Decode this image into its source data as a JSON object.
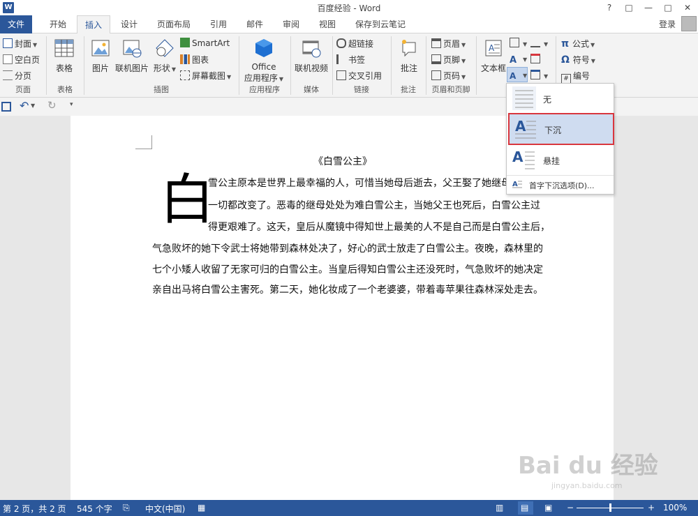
{
  "window": {
    "title": "百度经验 - Word",
    "help": "?",
    "restore": "□",
    "minimize": "—",
    "close": "✕"
  },
  "tabs": {
    "file": "文件",
    "items": [
      "开始",
      "插入",
      "设计",
      "页面布局",
      "引用",
      "邮件",
      "审阅",
      "视图",
      "保存到云笔记"
    ],
    "active": "插入",
    "login": "登录"
  },
  "ribbon": {
    "pages": {
      "cover": "封面",
      "blank": "空白页",
      "break": "分页",
      "label": "页面"
    },
    "tables": {
      "table": "表格",
      "label": "表格"
    },
    "illustrations": {
      "picture": "图片",
      "online_picture": "联机图片",
      "shapes": "形状",
      "smartart": "SmartArt",
      "chart": "图表",
      "screenshot": "屏幕截图",
      "label": "插图"
    },
    "apps": {
      "line1": "Office",
      "line2": "应用程序",
      "label": "应用程序"
    },
    "media": {
      "online_video": "联机视频",
      "label": "媒体"
    },
    "links": {
      "hyperlink": "超链接",
      "bookmark": "书签",
      "cross_ref": "交叉引用",
      "label": "链接"
    },
    "comments": {
      "comment": "批注",
      "label": "批注"
    },
    "header_footer": {
      "header": "页眉",
      "footer": "页脚",
      "page_number": "页码",
      "label": "页眉和页脚"
    },
    "text": {
      "textbox": "文本框"
    },
    "symbols": {
      "equation": "公式",
      "symbol": "符号",
      "number": "编号"
    }
  },
  "dropcap_menu": {
    "none": "无",
    "dropped": "下沉",
    "in_margin": "悬挂",
    "options": "首字下沉选项(D)..."
  },
  "document": {
    "title": "《白雪公主》",
    "dropcap": "白",
    "lines": [
      "雪公主原本是世界上最幸福的人，可惜当她母后逝去，父王娶了她继母后",
      "一切都改变了。恶毒的继母处处为难白雪公主，当她父王也死后，白雪公主过",
      "得更艰难了。这天，皇后从魔镜中得知世上最美的人不是自己而是白雪公主后，",
      "气急败坏的她下令武士将她带到森林处决了，好心的武士放走了白雪公主。夜晚，森林里的",
      "七个小矮人收留了无家可归的白雪公主。当皇后得知白雪公主还没死时，气急败坏的她决定",
      "亲自出马将白雪公主害死。第二天，她化妆成了一个老婆婆，带着毒苹果往森林深处走去。"
    ]
  },
  "status": {
    "page": "第 2 页，共 2 页",
    "words": "545 个字",
    "language": "中文(中国)",
    "zoom": "100%",
    "zoom_level": 1.0
  },
  "watermark": {
    "brand": "Bai du 经验",
    "url": "jingyan.baidu.com"
  },
  "colors": {
    "accent": "#2b579a",
    "highlight_border": "#d9363e",
    "highlight_fill": "#cfdcf0"
  }
}
